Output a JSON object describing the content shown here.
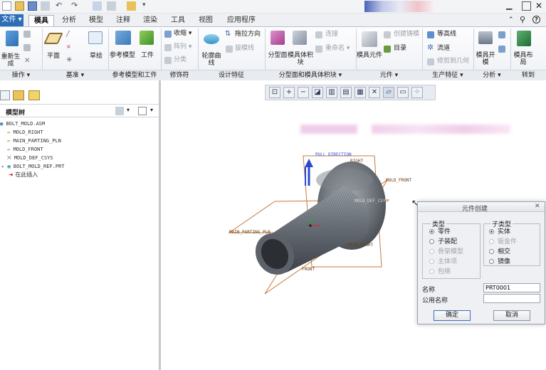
{
  "tabs": {
    "file": "文件",
    "mold": "模具",
    "analysis": "分析",
    "model": "模型",
    "annotation": "注释",
    "render": "渲染",
    "tools": "工具",
    "view": "视图",
    "apps": "应用程序"
  },
  "ribbon": {
    "regen": "重新生成",
    "operations": "操作",
    "plane": "平面",
    "sketch": "草绘",
    "datum": "基准",
    "ref_model": "参考模型",
    "workpiece": "工件",
    "ref_group": "参考模型和工件",
    "shrink": "收缩",
    "pattern": "阵列",
    "split": "分类",
    "modifiers": "修饰符",
    "contour": "轮廓曲线",
    "drag_direction": "拖拉方向",
    "skirt": "拔模线",
    "design_features": "设计特征",
    "parting_surface": "分型面",
    "mold_volume": "模具体积块",
    "connect": "连接",
    "rename": "重命名",
    "parting_group": "分型面和模具体积块",
    "component": "模具元件",
    "create_casting": "创建铸模",
    "catalog": "目录",
    "component_group": "元件",
    "waterline": "等高线",
    "runner": "流道",
    "trim": "修剪到几何",
    "production_group": "生产特征",
    "mold_open": "模具开模",
    "mold_layout": "模具布局",
    "analysis_group": "分析",
    "transfer_group": "转到"
  },
  "tree": {
    "title": "模型树",
    "items": [
      "BOLT_MOLD.ASM",
      "MOLD_RIGHT",
      "MAIN_PARTING_PLN",
      "MOLD_FRONT",
      "MOLD_DEF_CSYS",
      "BOLT_MOLD_REF.PRT",
      "在此插入"
    ]
  },
  "viewport": {
    "labels": {
      "pull": "PULL DIRECTION",
      "right_top": "RIGHT",
      "mold_front": "MOLD_FRONT",
      "csys": "MOLD_DEF_CSYS",
      "main": "MAIN_PARTING_PLN",
      "mold_right": "MOLD_RIGHT",
      "front": "FRONT"
    }
  },
  "dialog": {
    "title": "元件创建",
    "type_label": "类型",
    "subtype_label": "子类型",
    "types": [
      "零件",
      "子装配",
      "骨架模型",
      "主体项",
      "包络"
    ],
    "subtypes": [
      "实体",
      "钣金件",
      "相交",
      "镜像"
    ],
    "name_label": "名称",
    "name_value": "PRT0001",
    "common_name_label": "公用名称",
    "common_name_value": "",
    "ok": "确定",
    "cancel": "取消"
  },
  "colors": {
    "accent": "#2d6fb6",
    "plane": "#c8783a",
    "blur": "#e3a6d6"
  }
}
